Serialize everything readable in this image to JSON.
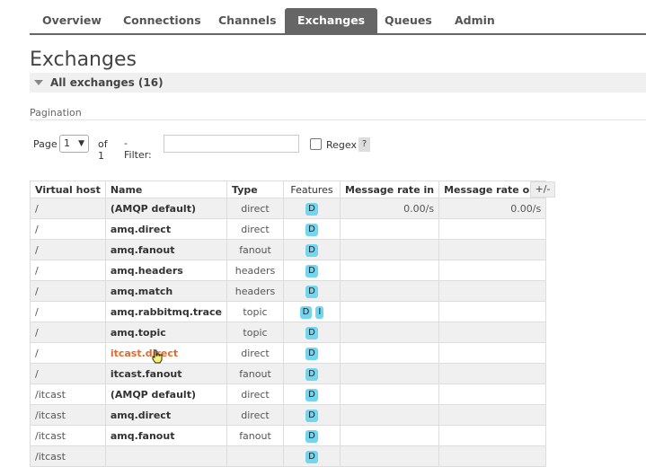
{
  "tabs": [
    {
      "label": "Overview",
      "active": false
    },
    {
      "label": "Connections",
      "active": false
    },
    {
      "label": "Channels",
      "active": false
    },
    {
      "label": "Exchanges",
      "active": true
    },
    {
      "label": "Queues",
      "active": false
    },
    {
      "label": "Admin",
      "active": false
    }
  ],
  "page_title": "Exchanges",
  "section": "All exchanges (16)",
  "pagination": {
    "label": "Pagination",
    "page_label": "Page",
    "page_value": "1",
    "of_label": "of 1",
    "filter_label": "- Filter:",
    "filter_value": "",
    "regex_label": "Regex",
    "help": "?"
  },
  "table": {
    "headers": [
      "Virtual host",
      "Name",
      "Type",
      "Features",
      "Message rate in",
      "Message rate out"
    ],
    "toggle": "+/-",
    "rows": [
      {
        "vhost": "/",
        "name": "(AMQP default)",
        "type": "direct",
        "features": [
          "D"
        ],
        "rate_in": "0.00/s",
        "rate_out": "0.00/s"
      },
      {
        "vhost": "/",
        "name": "amq.direct",
        "type": "direct",
        "features": [
          "D"
        ],
        "rate_in": "",
        "rate_out": ""
      },
      {
        "vhost": "/",
        "name": "amq.fanout",
        "type": "fanout",
        "features": [
          "D"
        ],
        "rate_in": "",
        "rate_out": ""
      },
      {
        "vhost": "/",
        "name": "amq.headers",
        "type": "headers",
        "features": [
          "D"
        ],
        "rate_in": "",
        "rate_out": ""
      },
      {
        "vhost": "/",
        "name": "amq.match",
        "type": "headers",
        "features": [
          "D"
        ],
        "rate_in": "",
        "rate_out": ""
      },
      {
        "vhost": "/",
        "name": "amq.rabbitmq.trace",
        "type": "topic",
        "features": [
          "D",
          "I"
        ],
        "rate_in": "",
        "rate_out": ""
      },
      {
        "vhost": "/",
        "name": "amq.topic",
        "type": "topic",
        "features": [
          "D"
        ],
        "rate_in": "",
        "rate_out": ""
      },
      {
        "vhost": "/",
        "name": "itcast.direct",
        "type": "direct",
        "features": [
          "D"
        ],
        "rate_in": "",
        "rate_out": "",
        "hover": true
      },
      {
        "vhost": "/",
        "name": "itcast.fanout",
        "type": "fanout",
        "features": [
          "D"
        ],
        "rate_in": "",
        "rate_out": ""
      },
      {
        "vhost": "/itcast",
        "name": "(AMQP default)",
        "type": "direct",
        "features": [
          "D"
        ],
        "rate_in": "",
        "rate_out": ""
      },
      {
        "vhost": "/itcast",
        "name": "amq.direct",
        "type": "direct",
        "features": [
          "D"
        ],
        "rate_in": "",
        "rate_out": ""
      },
      {
        "vhost": "/itcast",
        "name": "amq.fanout",
        "type": "fanout",
        "features": [
          "D"
        ],
        "rate_in": "",
        "rate_out": ""
      },
      {
        "vhost": "/itcast",
        "name": "",
        "type": "",
        "features": [
          "D"
        ],
        "rate_in": "",
        "rate_out": ""
      }
    ]
  },
  "colors": {
    "tab_active": "#666666",
    "link_hover": "#e16b2d",
    "badge": "#73d6ee"
  }
}
